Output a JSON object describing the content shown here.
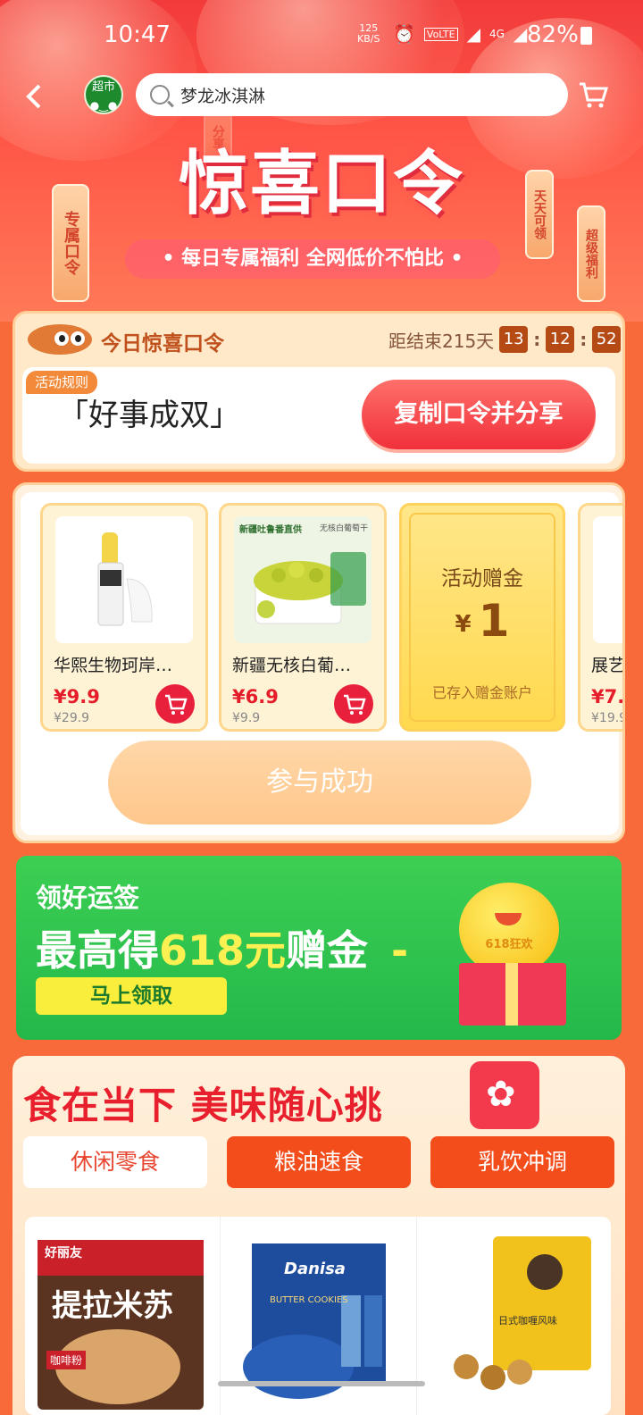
{
  "status_bar": {
    "time": "10:47",
    "network_speed": "125",
    "network_speed_unit": "KB/S",
    "network_type": "4G",
    "volte": "VoLTE",
    "battery": "82%"
  },
  "nav": {
    "store_badge": "超市",
    "search_text": "梦龙冰淇淋"
  },
  "banner": {
    "title": "惊喜口令",
    "subtitle": "• 每日专属福利 全网低价不怕比 •",
    "tags": [
      "专属口令",
      "分享",
      "天天可领",
      "超级福利",
      "天天可领"
    ]
  },
  "code_card": {
    "heading": "今日惊喜口令",
    "countdown_label": "距结束215天",
    "countdown": [
      "13",
      "12",
      "52"
    ],
    "rules_label": "活动规则",
    "code": "「好事成双」",
    "copy_button": "复制口令并分享"
  },
  "products": [
    {
      "name": "华熙生物珂岸…",
      "price": "¥9.9",
      "original_price": "¥29.9"
    },
    {
      "name": "新疆无核白葡…",
      "price": "¥6.9",
      "original_price": "¥9.9"
    },
    {
      "name": "展艺…",
      "price": "¥7.",
      "original_price": "¥19.9"
    }
  ],
  "product_image_labels": {
    "raisin_header": "新疆吐鲁番直供",
    "raisin_tag": "无核白葡萄干"
  },
  "gift_card": {
    "title": "活动赠金",
    "currency": "¥",
    "amount": "1",
    "note": "已存入赠金账户"
  },
  "join_button": "参与成功",
  "lucky": {
    "line1": "领好运签",
    "line2_prefix": "最高得",
    "line2_highlight": "618元",
    "line2_suffix": "赠金",
    "dash": "-",
    "claim_button": "马上领取",
    "ball_label": "618狂欢"
  },
  "food": {
    "title": "食在当下 美味随心挑",
    "tabs": [
      "休闲零食",
      "粮油速食",
      "乳饮冲调"
    ],
    "items": [
      {
        "brand": "好丽友",
        "name": "提拉米苏",
        "sub": "咖啡粉"
      },
      {
        "brand": "Danisa",
        "name": "BUTTER COOKIES"
      },
      {
        "brand": "",
        "name": "日式咖喱风味"
      }
    ]
  },
  "colors": {
    "accent_red": "#e8202e",
    "green_banner": "#2bc24e",
    "price_red": "#e51d2b"
  }
}
